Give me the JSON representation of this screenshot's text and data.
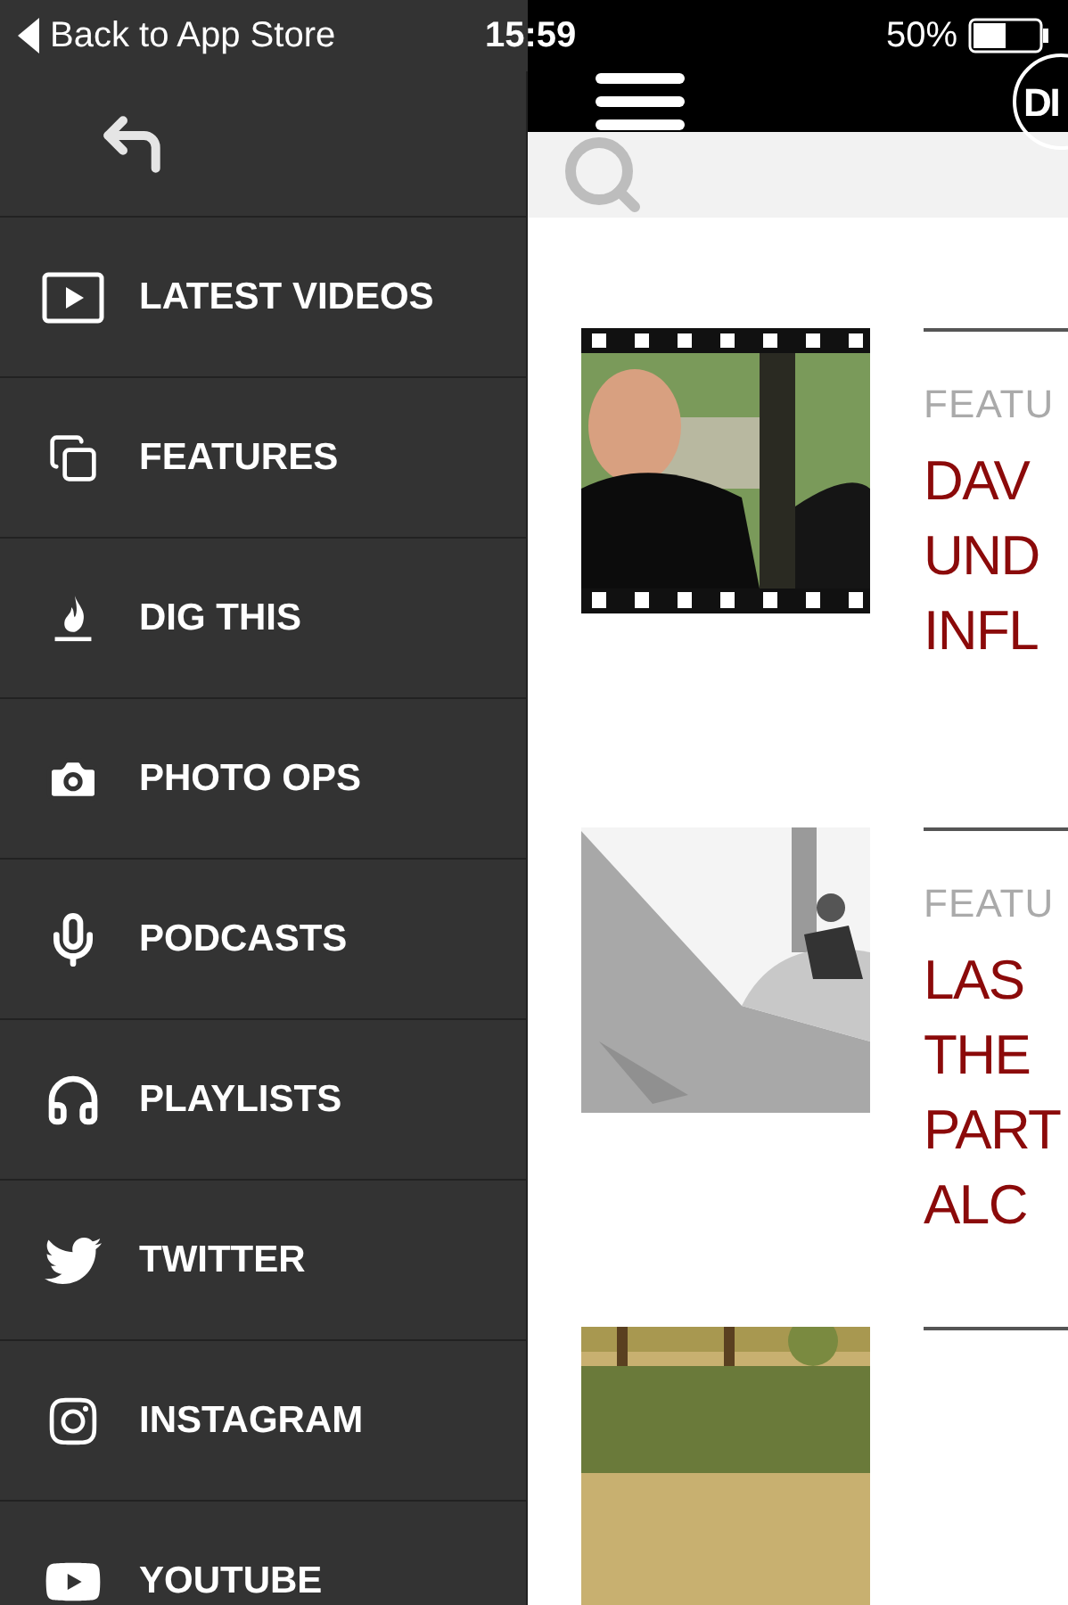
{
  "status_bar": {
    "back": "Back to App Store",
    "time": "15:59",
    "battery": "50%"
  },
  "header": {
    "logo": "DI"
  },
  "menu": [
    {
      "label": "LATEST VIDEOS"
    },
    {
      "label": "FEATURES"
    },
    {
      "label": "DIG THIS"
    },
    {
      "label": "PHOTO OPS"
    },
    {
      "label": "PODCASTS"
    },
    {
      "label": "PLAYLISTS"
    },
    {
      "label": "TWITTER"
    },
    {
      "label": "INSTAGRAM"
    },
    {
      "label": "YOUTUBE"
    }
  ],
  "articles": [
    {
      "category": "FEATU",
      "title_lines": [
        "DAV",
        "UND",
        "INFL"
      ],
      "kind": "picture"
    },
    {
      "category": "FEATU",
      "title_lines": [
        "LAS",
        "THE",
        "PART",
        "ALC"
      ],
      "kind": "picture"
    },
    {
      "kind": "picture"
    }
  ]
}
